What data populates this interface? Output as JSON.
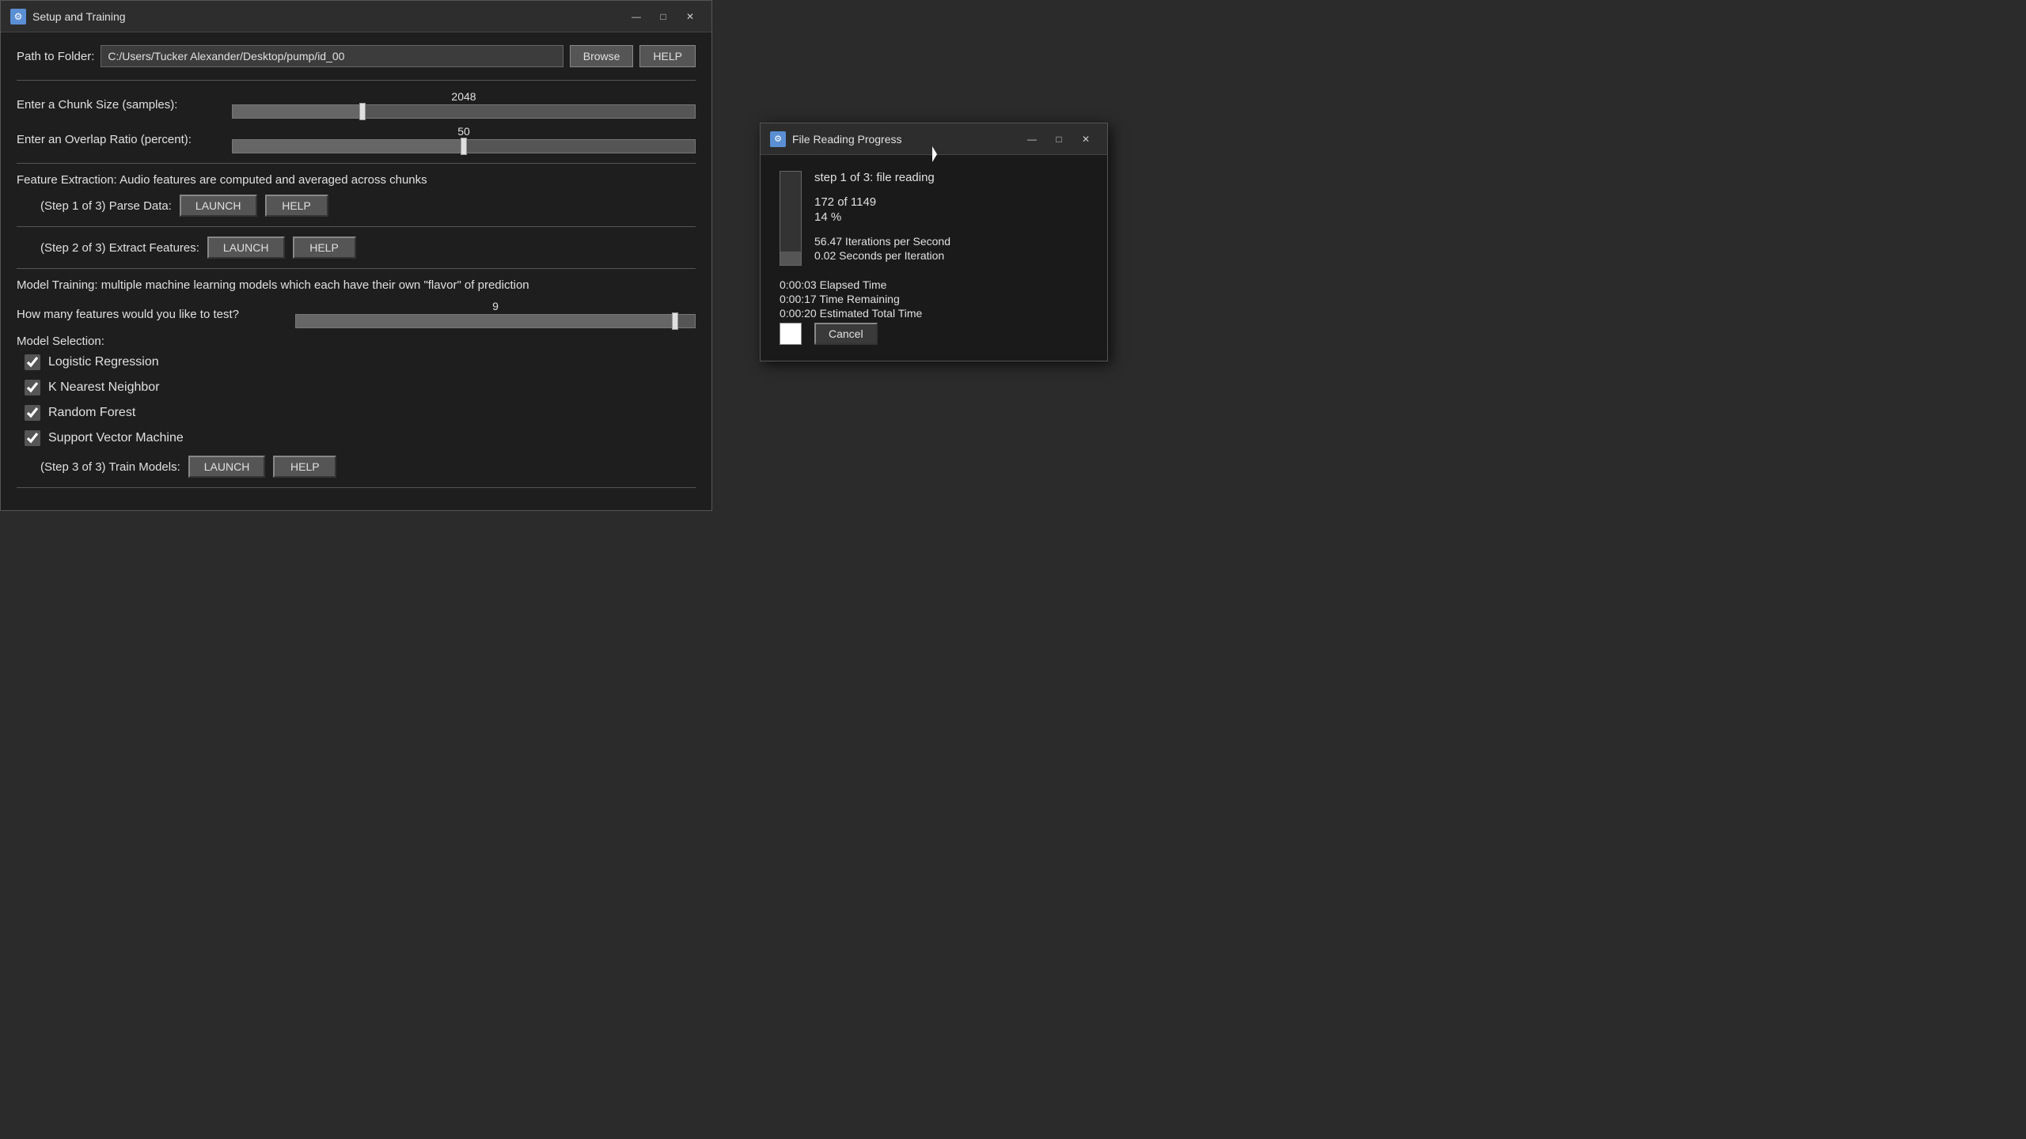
{
  "mainWindow": {
    "title": "Setup and Training",
    "icon": "⚙",
    "controls": {
      "minimize": "—",
      "maximize": "□",
      "close": "✕"
    }
  },
  "pathRow": {
    "label": "Path to Folder:",
    "value": "C:/Users/Tucker Alexander/Desktop/pump/id_00",
    "placeholder": "",
    "browseLabel": "Browse",
    "helpLabel": "HELP"
  },
  "chunkSize": {
    "label": "Enter a Chunk Size (samples):",
    "value": "2048",
    "sliderPercent": 28
  },
  "overlapRatio": {
    "label": "Enter an Overlap Ratio (percent):",
    "value": "50",
    "sliderPercent": 50
  },
  "featureExtraction": {
    "description": "Feature Extraction: Audio features are computed and averaged across chunks",
    "step1": {
      "label": "(Step 1 of 3) Parse Data:",
      "launchLabel": "LAUNCH",
      "helpLabel": "HELP"
    },
    "step2": {
      "label": "(Step 2 of 3) Extract Features:",
      "launchLabel": "LAUNCH",
      "helpLabel": "HELP"
    }
  },
  "modelTraining": {
    "description": "Model Training: multiple machine learning models which each have their own \"flavor\" of prediction",
    "featuresQuestion": "How many features would you like to test?",
    "featuresValue": "9",
    "featuresSliderPercent": 95,
    "modelSelectionLabel": "Model Selection:",
    "models": [
      {
        "name": "Logistic Regression",
        "checked": true
      },
      {
        "name": "K Nearest Neighbor",
        "checked": true
      },
      {
        "name": "Random Forest",
        "checked": true
      },
      {
        "name": "Support Vector Machine",
        "checked": true
      }
    ],
    "step3": {
      "label": "(Step 3 of 3) Train Models:",
      "launchLabel": "LAUNCH",
      "helpLabel": "HELP"
    }
  },
  "progressDialog": {
    "title": "File Reading Progress",
    "icon": "⚙",
    "controls": {
      "minimize": "—",
      "maximize": "□",
      "close": "✕"
    },
    "stepText": "step 1 of 3: file reading",
    "countText": "172 of 1149",
    "percentText": "14 %",
    "iterationsPerSecond": "56.47 Iterations per Second",
    "secondsPerIteration": "0.02 Seconds per Iteration",
    "elapsedTime": "0:00:03 Elapsed Time",
    "timeRemaining": "0:00:17 Time Remaining",
    "estimatedTotal": "0:00:20 Estimated Total Time",
    "progressBarFillPercent": 14,
    "cancelLabel": "Cancel"
  }
}
